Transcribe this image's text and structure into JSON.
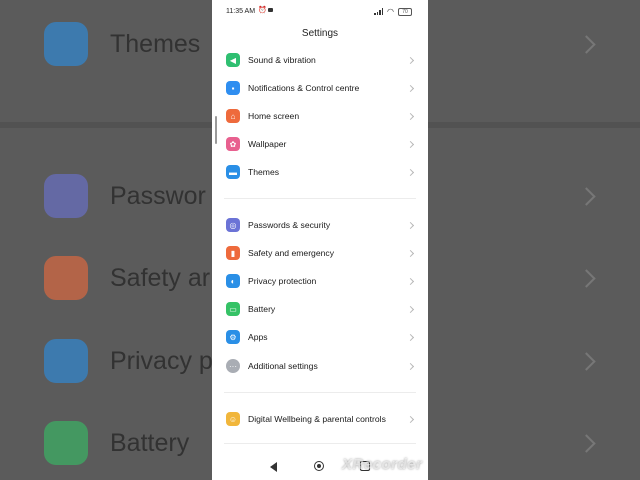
{
  "status_bar": {
    "time": "11:35 AM",
    "battery": "70"
  },
  "screen_title": "Settings",
  "items": [
    {
      "label": "Sound & vibration",
      "color": "#2fbf71"
    },
    {
      "label": "Notifications & Control centre",
      "color": "#2f8ef0"
    },
    {
      "label": "Home screen",
      "color": "#ee6a3c"
    },
    {
      "label": "Wallpaper",
      "color": "#e8608f"
    },
    {
      "label": "Themes",
      "color": "#2a8fe6"
    },
    {
      "label": "Passwords & security",
      "color": "#6b73d6"
    },
    {
      "label": "Safety and emergency",
      "color": "#ee6a3c"
    },
    {
      "label": "Privacy protection",
      "color": "#2a8fe6"
    },
    {
      "label": "Battery",
      "color": "#35c266"
    },
    {
      "label": "Apps",
      "color": "#2a8fe6"
    },
    {
      "label": "Additional settings",
      "color": "#a9adb4"
    },
    {
      "label": "Digital Wellbeing & parental controls",
      "color": "#f1b63b"
    }
  ],
  "background_zoom": {
    "labels": [
      "Themes",
      "Passwor",
      "Safety ar",
      "Privacy p",
      "Battery"
    ]
  },
  "watermark": "XRecorder"
}
